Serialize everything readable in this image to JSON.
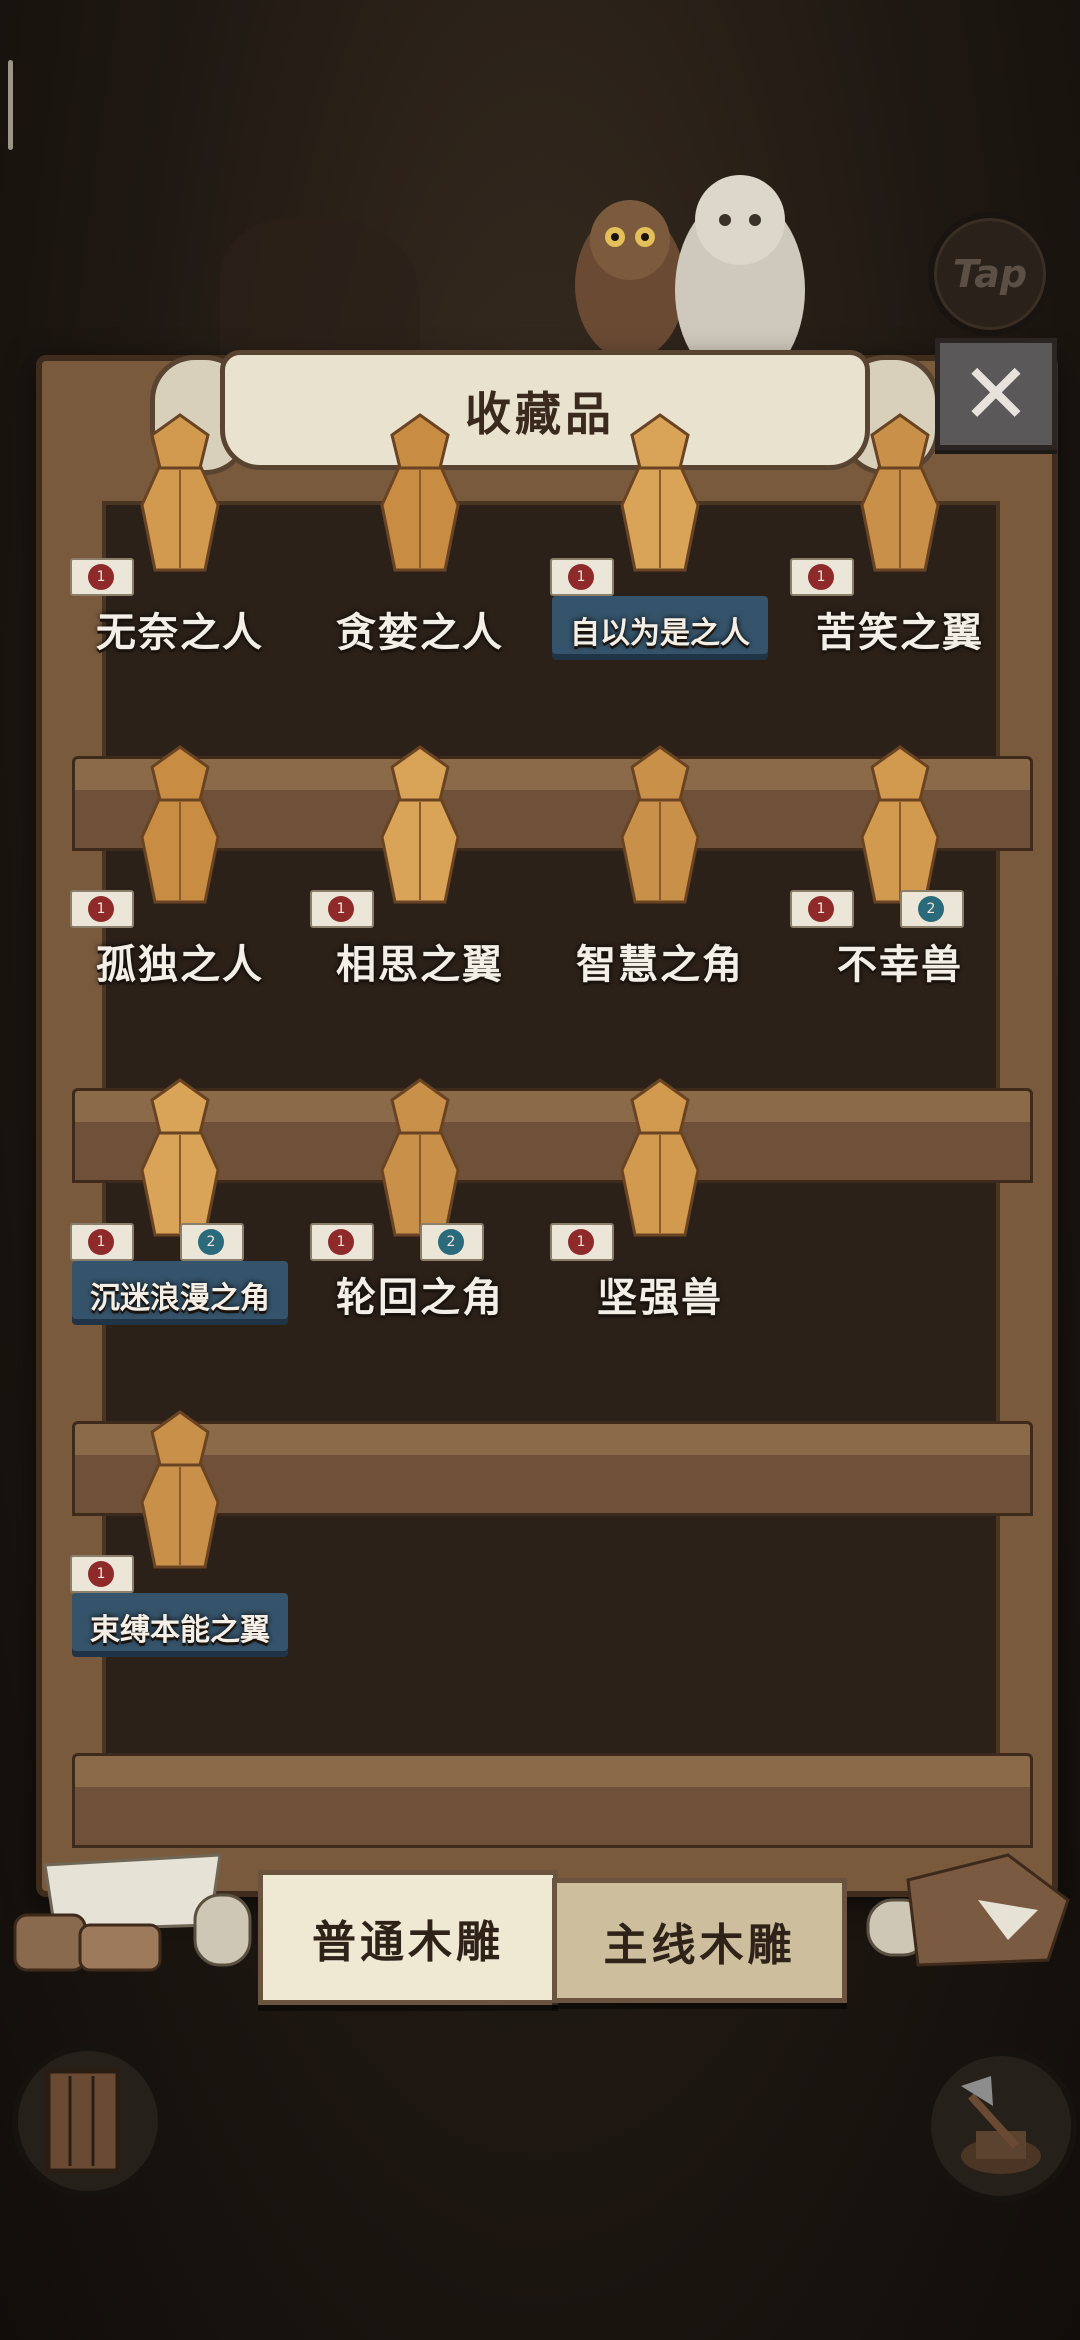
{
  "header": {
    "title": "收藏品",
    "tap_label": "Tap",
    "close_glyph": "✕"
  },
  "rows": [
    {
      "items": [
        {
          "label": "无奈之人",
          "tags": [
            "1"
          ],
          "highlight": false
        },
        {
          "label": "贪婪之人",
          "tags": [],
          "highlight": false
        },
        {
          "label": "自以为是之人",
          "tags": [
            "1"
          ],
          "highlight": true
        },
        {
          "label": "苦笑之翼",
          "tags": [
            "1"
          ],
          "highlight": false
        }
      ]
    },
    {
      "items": [
        {
          "label": "孤独之人",
          "tags": [
            "1"
          ],
          "highlight": false
        },
        {
          "label": "相思之翼",
          "tags": [
            "1"
          ],
          "highlight": false
        },
        {
          "label": "智慧之角",
          "tags": [],
          "highlight": false
        },
        {
          "label": "不幸兽",
          "tags": [
            "1",
            "2"
          ],
          "highlight": false
        }
      ]
    },
    {
      "items": [
        {
          "label": "沉迷浪漫之角",
          "tags": [
            "1",
            "2"
          ],
          "highlight": true
        },
        {
          "label": "轮回之角",
          "tags": [
            "1",
            "2"
          ],
          "highlight": false
        },
        {
          "label": "坚强兽",
          "tags": [
            "1"
          ],
          "highlight": false
        }
      ]
    },
    {
      "items": [
        {
          "label": "束缚本能之翼",
          "tags": [
            "1"
          ],
          "highlight": true
        }
      ]
    }
  ],
  "tabs": {
    "normal": "普通木雕",
    "main": "主线木雕"
  },
  "colors": {
    "wood_light": "#8b6a4a",
    "wood_dark": "#3e2a1a",
    "wax_red": "#8e2a2a",
    "wax_teal": "#2b6a7a",
    "highlight_blue": "#35536a"
  }
}
